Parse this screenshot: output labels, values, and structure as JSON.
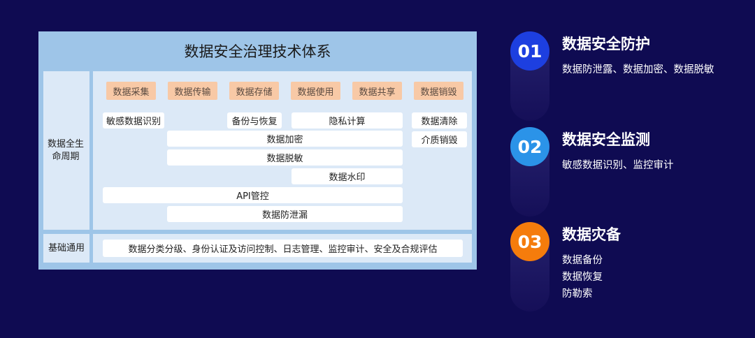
{
  "diagram": {
    "title": "数据安全治理技术体系",
    "lifecycle_label": "数据全生命周期",
    "stages": [
      "数据采集",
      "数据传输",
      "数据存储",
      "数据使用",
      "数据共享",
      "数据销毁"
    ],
    "capabilities": {
      "sensitive_id": "敏感数据识别",
      "backup_restore": "备份与恢复",
      "privacy_compute": "隐私计算",
      "data_clear": "数据清除",
      "encryption": "数据加密",
      "media_destroy": "介质销毁",
      "desensitize": "数据脱敏",
      "watermark": "数据水印",
      "api_control": "API管控",
      "dlp": "数据防泄漏"
    },
    "foundation_label": "基础通用",
    "foundation_text": "数据分类分级、身份认证及访问控制、日志管理、监控审计、安全及合规评估"
  },
  "items": [
    {
      "number": "01",
      "title": "数据安全防护",
      "desc": [
        "数据防泄露、数据加密、数据脱敏"
      ],
      "color": "#1d3fe0"
    },
    {
      "number": "02",
      "title": "数据安全监测",
      "desc": [
        "敏感数据识别、监控审计"
      ],
      "color": "#2b93e8"
    },
    {
      "number": "03",
      "title": "数据灾备",
      "desc": [
        "数据备份",
        "数据恢复",
        "防勒索"
      ],
      "color": "#f57c0c"
    }
  ]
}
